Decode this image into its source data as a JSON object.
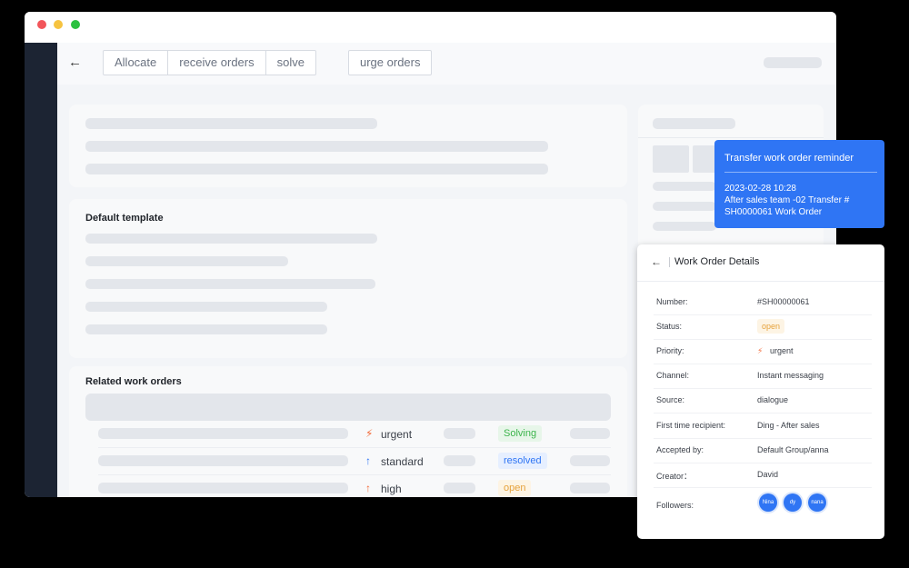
{
  "toolbar": {
    "buttons": [
      "Allocate",
      "receive orders",
      "solve"
    ],
    "urge_label": "urge orders"
  },
  "template_heading": "Default template",
  "related": {
    "heading": "Related work orders",
    "rows": [
      {
        "priority": "urgent",
        "priority_icon": "lightning-icon",
        "status": "Solving",
        "status_color": "#3cb44b"
      },
      {
        "priority": "standard",
        "priority_icon": "arrow-up-icon",
        "status": "resolved",
        "status_color": "#2f75f4"
      },
      {
        "priority": "high",
        "priority_icon": "arrow-up-icon",
        "status": "open",
        "status_color": "#e6a23c"
      }
    ]
  },
  "tooltip": {
    "title": "Transfer work order reminder",
    "time": "2023-02-28 10:28",
    "line1": "After sales team -02 Transfer #",
    "line2": "SH0000061 Work Order"
  },
  "details": {
    "title": "Work Order Details",
    "rows": [
      {
        "label": "Number:",
        "value": "#SH00000061"
      },
      {
        "label": "Status:",
        "value": "open"
      },
      {
        "label": "Priority:",
        "value": "urgent"
      },
      {
        "label": "Channel:",
        "value": "Instant messaging"
      },
      {
        "label": "Source:",
        "value": "dialogue"
      },
      {
        "label": "First time recipient:",
        "value": "Ding - After sales"
      },
      {
        "label": "Accepted by:",
        "value": "Default Group/anna"
      },
      {
        "label": "Creator：",
        "value": "David"
      },
      {
        "label": "Followers:",
        "value": ""
      }
    ],
    "followers": [
      "Nina",
      "dy",
      "nana"
    ]
  },
  "colors": {
    "accent": "#2f75f4",
    "urgent": "#f26b3a",
    "status_open": "#e6a23c"
  }
}
